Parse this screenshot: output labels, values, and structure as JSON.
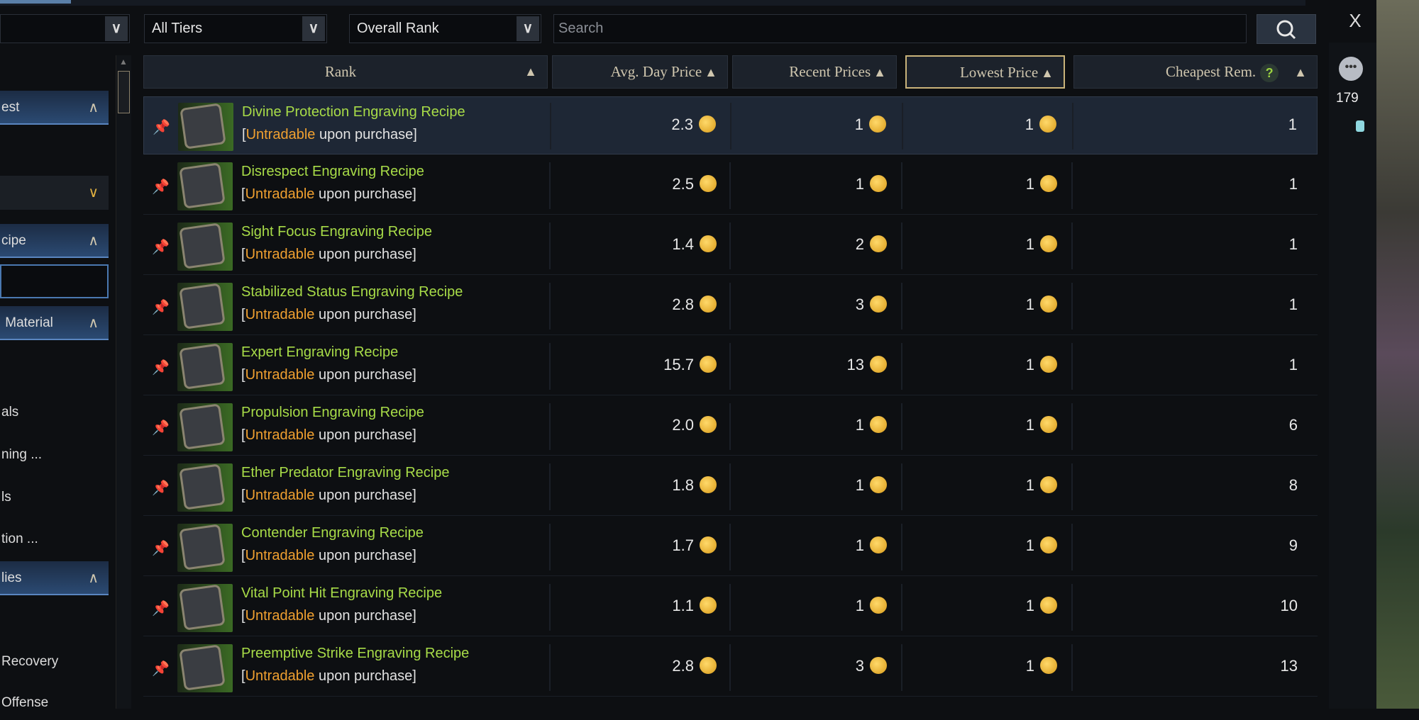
{
  "filters": {
    "category": "",
    "tier": "All Tiers",
    "sort": "Overall Rank",
    "search_placeholder": "Search",
    "close": "X"
  },
  "columns": {
    "rank": "Rank",
    "avg": "Avg. Day Price",
    "recent": "Recent Prices",
    "lowest": "Lowest Price",
    "cheapest": "Cheapest Rem.",
    "help": "?"
  },
  "sidebar": [
    {
      "label": "est",
      "style": "blue",
      "chev": "^"
    },
    {
      "label": "",
      "style": "dark",
      "chev": "v"
    },
    {
      "label": "cipe",
      "style": "blue",
      "chev": "^"
    },
    {
      "label": "",
      "style": "outline",
      "chev": ""
    },
    {
      "label": " Material",
      "style": "blue",
      "chev": "^"
    },
    {
      "label": "als",
      "style": "plain",
      "chev": ""
    },
    {
      "label": "ning ...",
      "style": "plain",
      "chev": ""
    },
    {
      "label": "ls",
      "style": "plain",
      "chev": ""
    },
    {
      "label": "tion ...",
      "style": "plain",
      "chev": ""
    },
    {
      "label": "lies",
      "style": "blue",
      "chev": "^"
    },
    {
      "label": "Recovery",
      "style": "plain",
      "chev": ""
    },
    {
      "label": "Offense",
      "style": "plain",
      "chev": ""
    }
  ],
  "subtitle": {
    "open": "[",
    "untradable": "Untradable",
    "rest": " upon purchase]"
  },
  "items": [
    {
      "name": "Divine Protection Engraving Recipe",
      "avg": "2.3",
      "recent": "1",
      "lowest": "1",
      "cheapest": "1"
    },
    {
      "name": "Disrespect Engraving Recipe",
      "avg": "2.5",
      "recent": "1",
      "lowest": "1",
      "cheapest": "1"
    },
    {
      "name": "Sight Focus Engraving Recipe",
      "avg": "1.4",
      "recent": "2",
      "lowest": "1",
      "cheapest": "1"
    },
    {
      "name": "Stabilized Status Engraving Recipe",
      "avg": "2.8",
      "recent": "3",
      "lowest": "1",
      "cheapest": "1"
    },
    {
      "name": "Expert Engraving Recipe",
      "avg": "15.7",
      "recent": "13",
      "lowest": "1",
      "cheapest": "1"
    },
    {
      "name": "Propulsion Engraving Recipe",
      "avg": "2.0",
      "recent": "1",
      "lowest": "1",
      "cheapest": "6"
    },
    {
      "name": "Ether Predator Engraving Recipe",
      "avg": "1.8",
      "recent": "1",
      "lowest": "1",
      "cheapest": "8"
    },
    {
      "name": "Contender Engraving Recipe",
      "avg": "1.7",
      "recent": "1",
      "lowest": "1",
      "cheapest": "9"
    },
    {
      "name": "Vital Point Hit Engraving Recipe",
      "avg": "1.1",
      "recent": "1",
      "lowest": "1",
      "cheapest": "10"
    },
    {
      "name": "Preemptive Strike Engraving Recipe",
      "avg": "2.8",
      "recent": "3",
      "lowest": "1",
      "cheapest": "13"
    }
  ],
  "right_strip": {
    "count": "179"
  },
  "colors": {
    "item_name": "#a8dc48",
    "untradable": "#f0a030",
    "active_header_border": "#c9b37a",
    "coin": "#e0a820"
  }
}
